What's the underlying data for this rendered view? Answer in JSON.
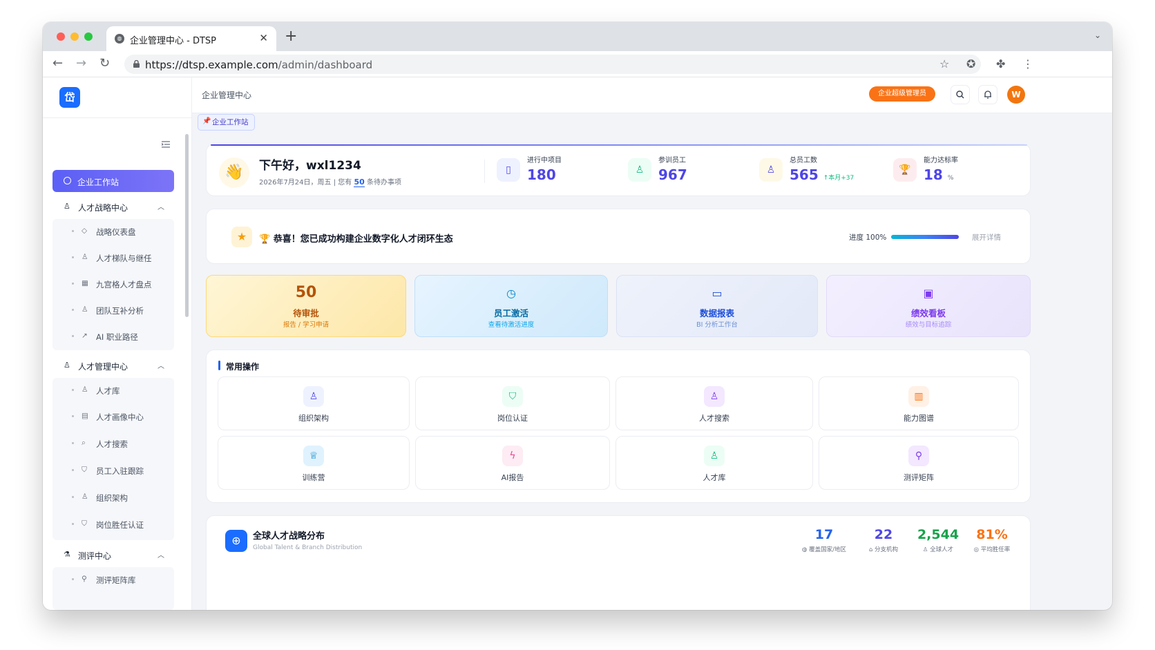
{
  "browser": {
    "tab_title": "企业管理中心 - DTSP",
    "url_host": "https://dtsp.example.com",
    "url_path": "/admin/dashboard"
  },
  "header": {
    "title": "企业管理中心",
    "role_badge": "企业超级管理员",
    "avatar_letter": "W"
  },
  "tags": {
    "active": "企业工作站"
  },
  "sidebar": {
    "active_item": "企业工作站",
    "groups": [
      {
        "label": "人才战略中心",
        "items": [
          "战略仪表盘",
          "人才梯队与继任",
          "九宫格人才盘点",
          "团队互补分析",
          "AI 职业路径"
        ]
      },
      {
        "label": "人才管理中心",
        "items": [
          "人才库",
          "人才画像中心",
          "人才搜索",
          "员工入驻跟踪",
          "组织架构",
          "岗位胜任认证"
        ]
      },
      {
        "label": "测评中心",
        "items": [
          "测评矩阵库"
        ]
      }
    ]
  },
  "welcome": {
    "greeting": "下午好，wxl1234",
    "date_prefix": "2026年7月24日，周五 | 您有",
    "pending_count": "50",
    "date_suffix": "条待办事项",
    "stats": [
      {
        "label": "进行中项目",
        "value": "180",
        "icon": "file-icon",
        "color": "#4f46e5",
        "bg": "#eef2ff"
      },
      {
        "label": "参训员工",
        "value": "967",
        "icon": "people-icon",
        "color": "#4f46e5",
        "bg": "#ecfdf5"
      },
      {
        "label": "总员工数",
        "value": "565",
        "extra": "↑本月+37",
        "icon": "users-icon",
        "color": "#4f46e5",
        "bg": "#fef3c7"
      },
      {
        "label": "能力达标率",
        "value": "18",
        "unit": "%",
        "icon": "trophy-icon",
        "color": "#4f46e5",
        "bg": "#fdecef"
      }
    ]
  },
  "congrats": {
    "text": "🏆 恭喜！您已成功构建企业数字化人才闭环生态",
    "progress_label": "进度 100%",
    "progress": 1.0,
    "expand_label": "展开详情"
  },
  "quick_cards": [
    {
      "value": "50",
      "title": "待审批",
      "sub": "报告 / 学习申请"
    },
    {
      "icon": "clock-icon",
      "title": "员工激活",
      "sub": "查看待激活进度"
    },
    {
      "icon": "monitor-icon",
      "title": "数据报表",
      "sub": "BI 分析工作台"
    },
    {
      "icon": "board-icon",
      "title": "绩效看板",
      "sub": "绩效与目标追踪"
    }
  ],
  "common_ops": {
    "title": "常用操作",
    "items": [
      "组织架构",
      "岗位认证",
      "人才搜索",
      "能力图谱",
      "训练营",
      "AI报告",
      "人才库",
      "测评矩阵"
    ]
  },
  "global": {
    "title": "全球人才战略分布",
    "subtitle": "Global Talent & Branch Distribution",
    "stats": [
      {
        "value": "17",
        "label": "覆盖国家/地区",
        "color": "#2563eb"
      },
      {
        "value": "22",
        "label": "分支机构",
        "color": "#4f46e5"
      },
      {
        "value": "2,544",
        "label": "全球人才",
        "color": "#16a34a"
      },
      {
        "value": "81%",
        "label": "平均胜任率",
        "color": "#f97316"
      }
    ]
  }
}
